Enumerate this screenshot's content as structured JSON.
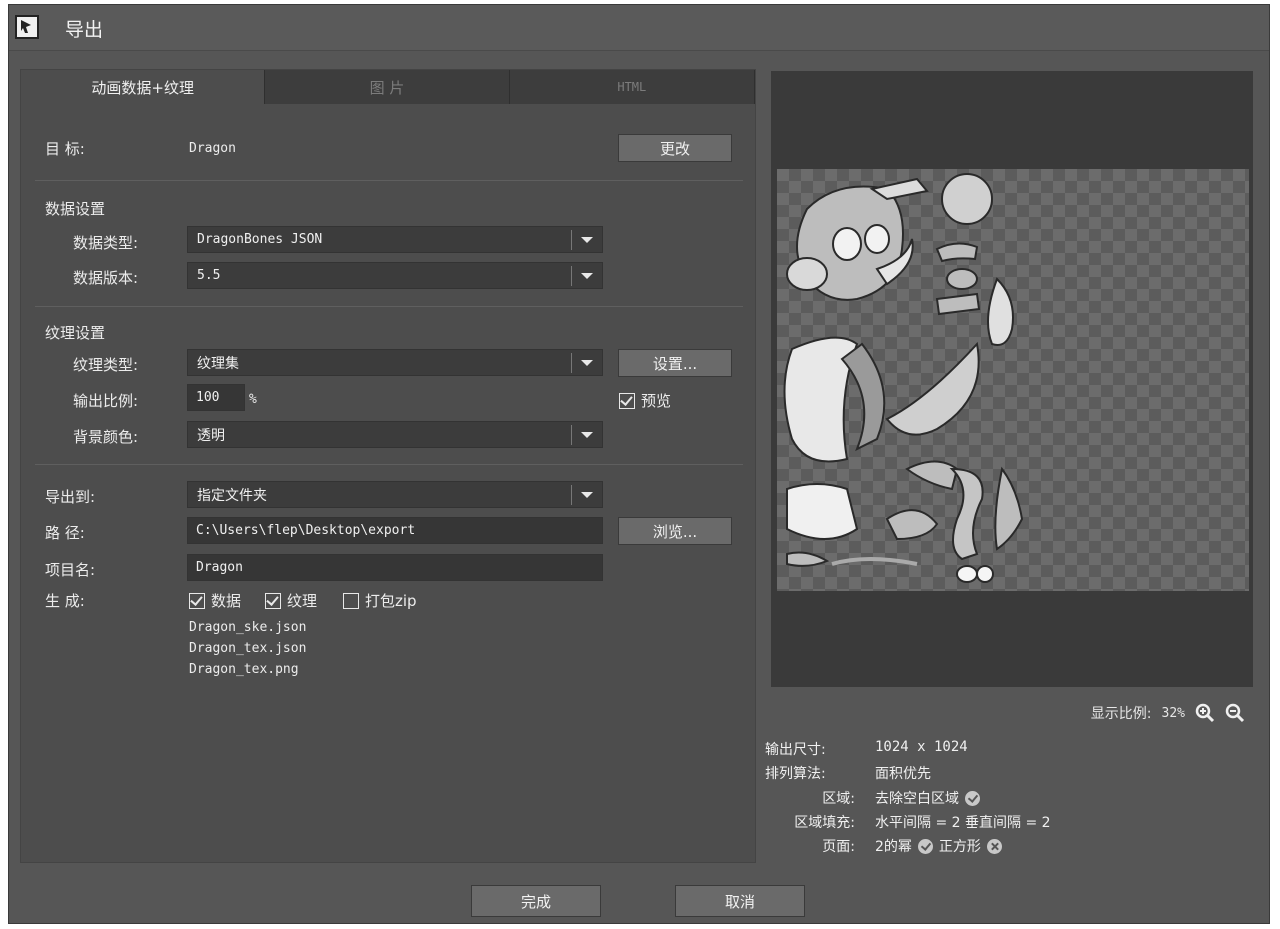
{
  "window": {
    "title": "导出"
  },
  "tabs": [
    {
      "label": "动画数据+纹理",
      "active": true
    },
    {
      "label": "图 片",
      "active": false
    },
    {
      "label": "HTML",
      "active": false
    }
  ],
  "target": {
    "label": "目  标:",
    "value": "Dragon",
    "change_button": "更改"
  },
  "data_settings": {
    "heading": "数据设置",
    "type_label": "数据类型:",
    "type_value": "DragonBones JSON",
    "version_label": "数据版本:",
    "version_value": "5.5"
  },
  "texture_settings": {
    "heading": "纹理设置",
    "type_label": "纹理类型:",
    "type_value": "纹理集",
    "settings_button": "设置...",
    "scale_label": "输出比例:",
    "scale_value": "100",
    "scale_unit": "%",
    "preview_label": "预览",
    "preview_checked": true,
    "bg_label": "背景颜色:",
    "bg_value": "透明"
  },
  "export": {
    "to_label": "导出到:",
    "to_value": "指定文件夹",
    "path_label": "路  径:",
    "path_value": "C:\\Users\\flep\\Desktop\\export",
    "browse_button": "浏览...",
    "project_label": "项目名:",
    "project_value": "Dragon",
    "generate_label": "生  成:",
    "options": [
      {
        "label": "数据",
        "checked": true
      },
      {
        "label": "纹理",
        "checked": true
      },
      {
        "label": "打包zip",
        "checked": false
      }
    ],
    "files": [
      "Dragon_ske.json",
      "Dragon_tex.json",
      "Dragon_tex.png"
    ]
  },
  "preview": {
    "zoom_label": "显示比例:",
    "zoom_value": "32%",
    "zoom_in_icon": "zoom-in-icon",
    "zoom_out_icon": "zoom-out-icon"
  },
  "info": {
    "size_label": "输出尺寸:",
    "size_value": "1024 x 1024",
    "algo_label": "排列算法:",
    "algo_value": "面积优先",
    "region_label": "区域:",
    "region_value": "去除空白区域",
    "padding_label": "区域填充:",
    "padding_value": "水平间隔 = 2 垂直间隔 = 2",
    "page_label": "页面:",
    "page_value_1": "2的幂",
    "page_value_2": "正方形"
  },
  "footer": {
    "ok_button": "完成",
    "cancel_button": "取消"
  }
}
